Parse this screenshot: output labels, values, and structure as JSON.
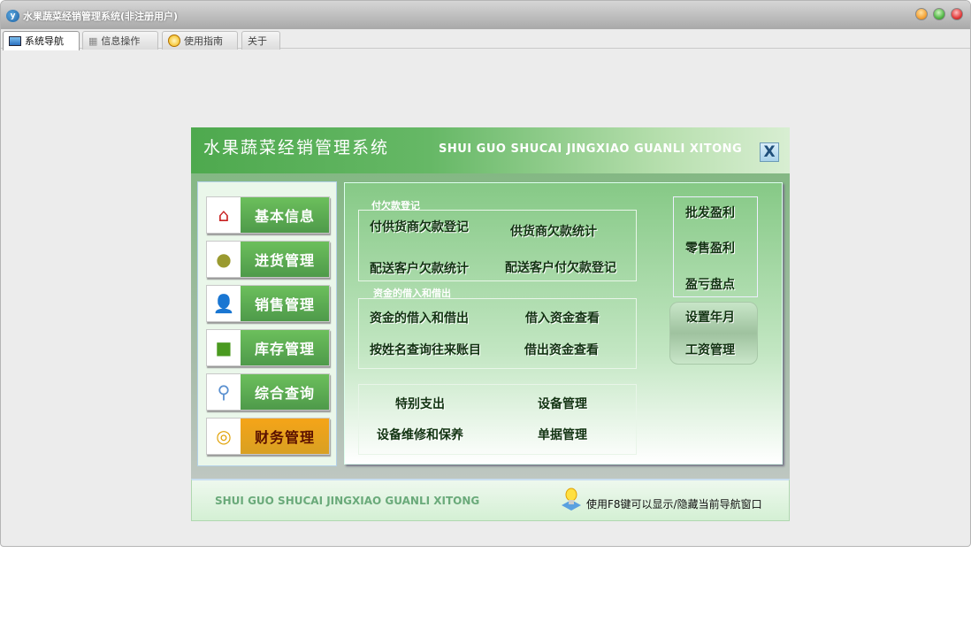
{
  "window": {
    "title": "水果蔬菜经销管理系统(非注册用户)",
    "controls": {
      "minimize_color": "#f4a43a",
      "maximize_color": "#54b948",
      "close_color": "#e23b3b"
    }
  },
  "tabs": [
    {
      "label": "系统导航",
      "icon": "monitor-icon"
    },
    {
      "label": "信息操作",
      "icon": "grid-icon"
    },
    {
      "label": "使用指南",
      "icon": "help-icon"
    },
    {
      "label": "关于"
    }
  ],
  "panel": {
    "title_cn": "水果蔬菜经销管理系统",
    "title_en": "SHUI GUO SHUCAI JINGXIAO GUANLI XITONG",
    "close_label": "X",
    "nav": [
      {
        "label": "基本信息",
        "icon": "house-icon"
      },
      {
        "label": "进货管理",
        "icon": "apple-icon"
      },
      {
        "label": "销售管理",
        "icon": "user-bag-icon"
      },
      {
        "label": "库存管理",
        "icon": "box-icon"
      },
      {
        "label": "综合查询",
        "icon": "magnifier-icon"
      },
      {
        "label": "财务管理",
        "icon": "coins-icon",
        "selected": true
      }
    ],
    "groups": {
      "debt": {
        "label": "付欠款登记",
        "items": [
          "付供货商欠款登记",
          "供货商欠款统计",
          "配送客户欠款统计",
          "配送客户付欠款登记"
        ]
      },
      "funds": {
        "label": "资金的借入和借出",
        "items": [
          "资金的借入和借出",
          "借入资金查看",
          "按姓名查询往来账目",
          "借出资金查看"
        ]
      },
      "other": {
        "items": [
          "特别支出",
          "设备管理",
          "设备维修和保养",
          "单据管理"
        ]
      },
      "profit": {
        "items": [
          "批发盈利",
          "零售盈利",
          "盈亏盘点"
        ]
      },
      "settings": {
        "items": [
          "设置年月",
          "工资管理"
        ]
      }
    },
    "footer": {
      "en": "SHUI GUO SHUCAI JINGXIAO GUANLI XITONG",
      "tip": "使用F8键可以显示/隐藏当前导航窗口"
    }
  }
}
